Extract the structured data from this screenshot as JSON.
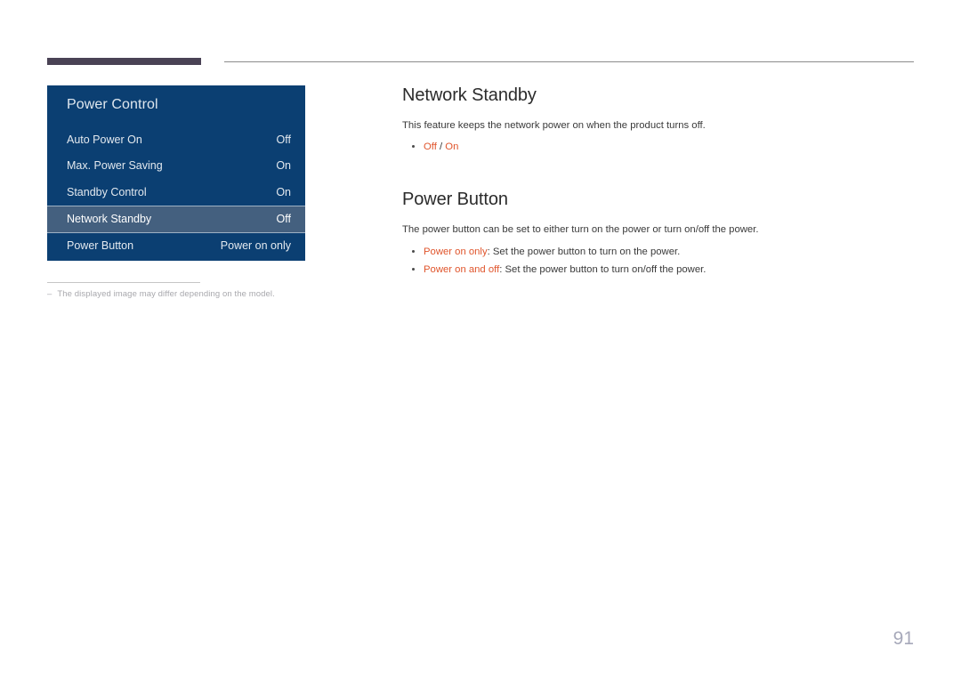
{
  "header": {
    "accent_color": "#4a4255",
    "rule_color": "#8b8b8b"
  },
  "osd_panel": {
    "title": "Power Control",
    "background_color": "#0b3f72",
    "selected_color": "#44607f",
    "rows": [
      {
        "label": "Auto Power On",
        "value": "Off",
        "selected": false
      },
      {
        "label": "Max. Power Saving",
        "value": "On",
        "selected": false
      },
      {
        "label": "Standby Control",
        "value": "On",
        "selected": false
      },
      {
        "label": "Network Standby",
        "value": "Off",
        "selected": true
      },
      {
        "label": "Power Button",
        "value": "Power on only",
        "selected": false
      }
    ]
  },
  "footnote": {
    "dash": "–",
    "text": "The displayed image may differ depending on the model."
  },
  "content": {
    "accent_color": "#e0552c",
    "sections": [
      {
        "heading": "Network Standby",
        "paragraph": "This feature keeps the network power on when the product turns off.",
        "bullets": [
          {
            "term": "Off",
            "separator": " / ",
            "term2": "On",
            "rest": ""
          }
        ]
      },
      {
        "heading": "Power Button",
        "paragraph": "The power button can be set to either turn on the power or turn on/off the power.",
        "bullets": [
          {
            "term": "Power on only",
            "rest": ": Set the power button to turn on the power."
          },
          {
            "term": "Power on and off",
            "rest": ": Set the power button to turn on/off the power."
          }
        ]
      }
    ]
  },
  "page_number": "91"
}
